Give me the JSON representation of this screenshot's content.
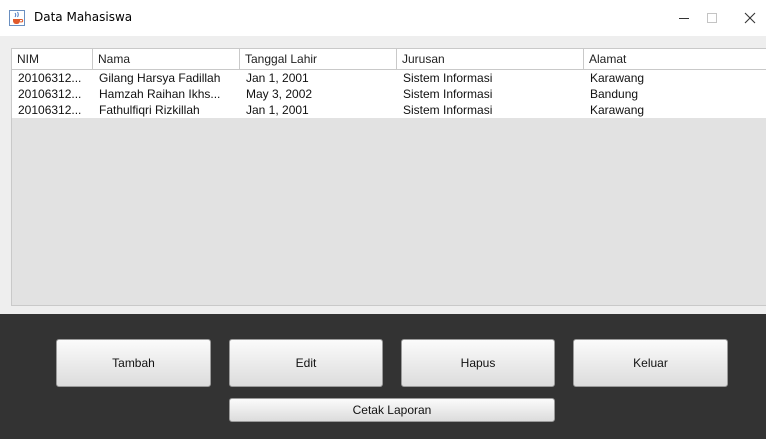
{
  "window": {
    "title": "Data Mahasiswa",
    "icon": "java-cup-icon"
  },
  "table": {
    "columns": [
      "NIM",
      "Nama",
      "Tanggal Lahir",
      "Jurusan",
      "Alamat"
    ],
    "rows": [
      [
        "20106312...",
        "Gilang Harsya Fadillah",
        "Jan 1, 2001",
        "Sistem Informasi",
        "Karawang"
      ],
      [
        "20106312...",
        "Hamzah Raihan Ikhs...",
        "May 3, 2002",
        "Sistem Informasi",
        "Bandung"
      ],
      [
        "20106312...",
        "Fathulfiqri Rizkillah",
        "Jan 1, 2001",
        "Sistem Informasi",
        "Karawang"
      ]
    ]
  },
  "buttons": {
    "tambah": "Tambah",
    "edit": "Edit",
    "hapus": "Hapus",
    "keluar": "Keluar",
    "cetak_laporan": "Cetak Laporan"
  },
  "colors": {
    "panel_dark": "#333333",
    "table_empty": "#e2e2e2"
  }
}
